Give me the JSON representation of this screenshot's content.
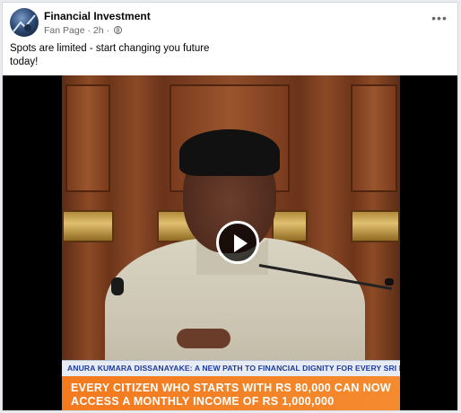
{
  "post": {
    "page_name": "Financial Investment",
    "page_type": "Fan Page",
    "time": "2h",
    "separator": "·",
    "caption": "Spots are limited - start changing you future today!",
    "more_icon": "ellipsis-icon"
  },
  "video": {
    "lower_third_title": "ANURA KUMARA DISSANAYAKE: A NEW PATH TO FINANCIAL DIGNITY FOR EVERY SRI LANKAN",
    "banner_line1": "EVERY CITIZEN WHO STARTS WITH RS 80,000 CAN NOW",
    "banner_line2": "ACCESS A MONTHLY INCOME OF RS 1,000,000",
    "play_icon": "play-icon",
    "colors": {
      "banner": "#f37a1f",
      "title_text": "#1d3a9c"
    }
  }
}
